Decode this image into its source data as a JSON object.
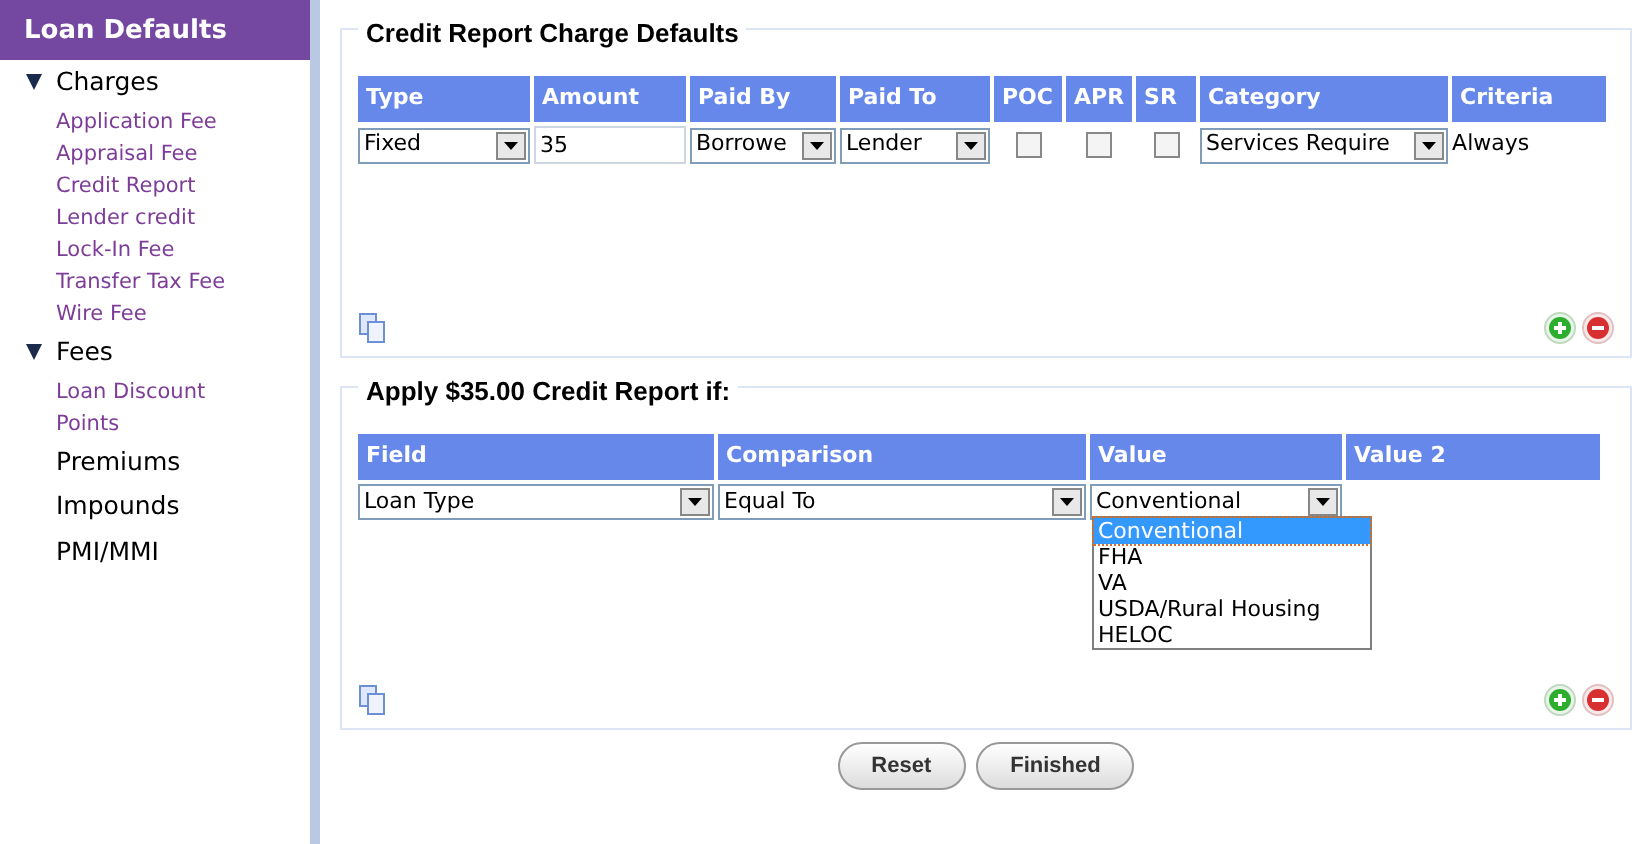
{
  "sidebar": {
    "title": "Loan Defaults",
    "items": [
      {
        "label": "Charges",
        "kind": "group",
        "expanded": true,
        "children": [
          {
            "label": "Application Fee"
          },
          {
            "label": "Appraisal Fee"
          },
          {
            "label": "Credit Report"
          },
          {
            "label": "Lender credit"
          },
          {
            "label": "Lock-In Fee"
          },
          {
            "label": "Transfer Tax Fee"
          },
          {
            "label": "Wire Fee"
          }
        ]
      },
      {
        "label": "Fees",
        "kind": "group",
        "expanded": true,
        "children": [
          {
            "label": "Loan Discount Points"
          }
        ]
      },
      {
        "label": "Premiums",
        "kind": "plain"
      },
      {
        "label": "Impounds",
        "kind": "plain"
      },
      {
        "label": "PMI/MMI",
        "kind": "plain"
      }
    ]
  },
  "charges_section": {
    "legend": "Credit Report Charge Defaults",
    "columns": [
      "Type",
      "Amount",
      "Paid By",
      "Paid To",
      "POC",
      "APR",
      "SR",
      "Category",
      "Criteria"
    ],
    "row": [
      {
        "kind": "select",
        "value": "Fixed"
      },
      {
        "kind": "input",
        "value": "35"
      },
      {
        "kind": "select",
        "value": "Borrowe"
      },
      {
        "kind": "select",
        "value": "Lender"
      },
      {
        "kind": "checkbox",
        "checked": false
      },
      {
        "kind": "checkbox",
        "checked": false
      },
      {
        "kind": "checkbox",
        "checked": false
      },
      {
        "kind": "select",
        "value": "Services Require"
      },
      {
        "kind": "text",
        "value": "Always"
      }
    ]
  },
  "conditions_section": {
    "legend": "Apply $35.00 Credit Report if:",
    "columns": [
      "Field",
      "Comparison",
      "Value",
      "Value 2"
    ],
    "row": [
      {
        "kind": "select",
        "value": "Loan Type"
      },
      {
        "kind": "select",
        "value": "Equal To"
      },
      {
        "kind": "select",
        "value": "Conventional"
      },
      {
        "kind": "empty"
      }
    ],
    "dropdown": [
      {
        "label": "Conventional",
        "selected": true
      },
      {
        "label": "FHA",
        "selected": false
      },
      {
        "label": "VA",
        "selected": false
      },
      {
        "label": "USDA/Rural Housing",
        "selected": false
      },
      {
        "label": "HELOC",
        "selected": false
      }
    ]
  },
  "buttons": [
    {
      "label": "Reset"
    },
    {
      "label": "Finished"
    }
  ]
}
